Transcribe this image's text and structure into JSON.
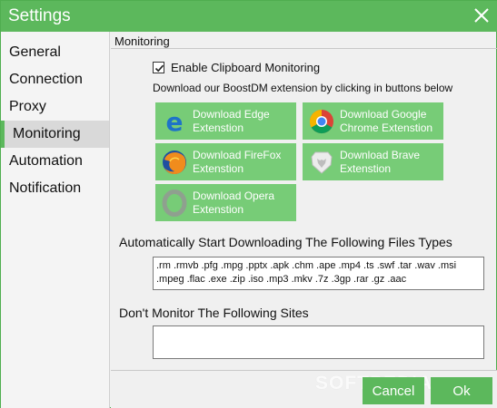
{
  "window": {
    "title": "Settings"
  },
  "sidebar": {
    "items": [
      {
        "label": "General",
        "active": false
      },
      {
        "label": "Connection",
        "active": false
      },
      {
        "label": "Proxy",
        "active": false
      },
      {
        "label": "Monitoring",
        "active": true
      },
      {
        "label": "Automation",
        "active": false
      },
      {
        "label": "Notification",
        "active": false
      }
    ]
  },
  "monitoring": {
    "header": "Monitoring",
    "clipboard": {
      "label": "Enable Clipboard Monitoring",
      "checked": true
    },
    "hint": "Download our BoostDM extension by clicking in buttons below",
    "extensions": [
      {
        "label": "Download Edge\nExtenstion",
        "icon": "edge-icon"
      },
      {
        "label": "Download Google\nChrome Extenstion",
        "icon": "chrome-icon"
      },
      {
        "label": "Download FireFox\nExtenstion",
        "icon": "firefox-icon"
      },
      {
        "label": "Download Brave\nExtenstion",
        "icon": "brave-icon"
      },
      {
        "label": "Download Opera\nExtenstion",
        "icon": "opera-icon"
      }
    ],
    "file_types_label": "Automatically Start Downloading The Following Files Types",
    "file_types_value": ".rm .rmvb .pfg .mpg .pptx .apk .chm .ape .mp4 .ts .swf .tar .wav .msi .mpeg .flac .exe .zip .iso .mp3 .mkv .7z .3gp .rar .gz .aac",
    "sites_label": "Don't Monitor The Following Sites",
    "sites_value": ""
  },
  "footer": {
    "cancel_label": "Cancel",
    "ok_label": "Ok",
    "watermark": "SOFTPEDIA"
  },
  "colors": {
    "accent": "#5cb85c",
    "button": "#77cc77",
    "text": "#111111"
  }
}
